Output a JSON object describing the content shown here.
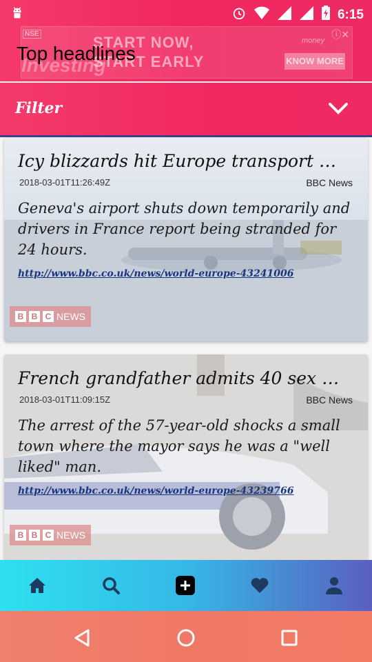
{
  "status_bar": {
    "time": "6:15"
  },
  "ad_banner": {
    "badge": "NSE",
    "brand": "Investing",
    "line1": "START NOW,",
    "line2": "START EARLY",
    "partner": "money",
    "cta": "KNOW MORE"
  },
  "header": {
    "title": "Top headlines"
  },
  "filter": {
    "label": "Filter"
  },
  "articles": [
    {
      "headline": "Icy blizzards hit Europe transport sy...",
      "date": "2018-03-01T11:26:49Z",
      "source": "BBC News",
      "description": "Geneva's airport shuts down temporarily and drivers in France report being stranded for 24 hours.",
      "url": "http://www.bbc.co.uk/news/world-europe-43241006",
      "badge": "NEWS"
    },
    {
      "headline": "French grandfather admits 40 sex a...",
      "date": "2018-03-01T11:09:15Z",
      "source": "BBC News",
      "description": "The arrest of the 57-year-old shocks a small town where the mayor says he was a \"well liked\" man.",
      "url": "http://www.bbc.co.uk/news/world-europe-43239766",
      "badge": "NEWS"
    }
  ],
  "bottom_nav": {
    "items": [
      "home-icon",
      "search-icon",
      "add-icon",
      "heart-icon",
      "person-icon"
    ]
  },
  "colors": {
    "accent": "#f12860",
    "nav_dark": "#1f3a5f"
  }
}
